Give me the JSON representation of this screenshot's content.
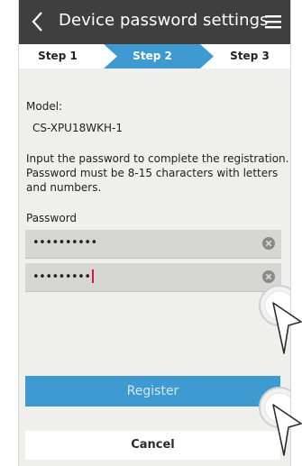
{
  "header": {
    "title": "Device password settings",
    "back_icon": "back-chevron-icon",
    "menu_icon": "hamburger-menu-icon"
  },
  "steps": [
    "Step 1",
    "Step 2",
    "Step 3"
  ],
  "model": {
    "label": "Model:",
    "value": "CS-XPU18WKH-1"
  },
  "instructions": {
    "line1": "Input the password to complete the registration.",
    "line2": "Password must be 8-15 characters with letters",
    "line3": "and numbers."
  },
  "password": {
    "label": "Password",
    "field1_value": "••••••••••",
    "field2_value": "•••••••••"
  },
  "buttons": {
    "register": "Register",
    "cancel": "Cancel"
  },
  "colors": {
    "header_bg": "#3f3f3f",
    "active_step": "#3f9ad2",
    "register_bg": "#3f9ad2",
    "cursor": "#d01848"
  }
}
